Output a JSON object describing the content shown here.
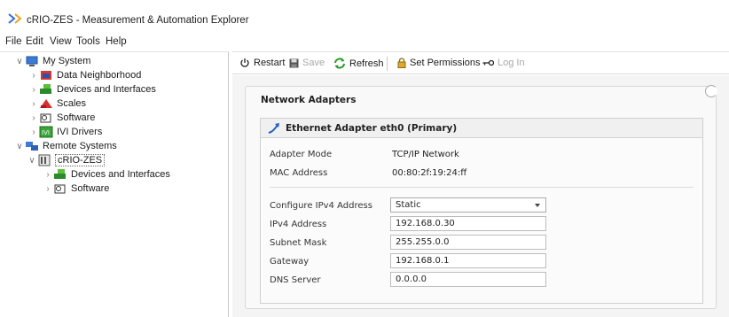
{
  "window": {
    "title": "cRIO-ZES - Measurement & Automation Explorer"
  },
  "menu": [
    "File",
    "Edit",
    "View",
    "Tools",
    "Help"
  ],
  "tree": {
    "my_system": "My System",
    "data_neighborhood": "Data Neighborhood",
    "devices_interfaces": "Devices and Interfaces",
    "scales": "Scales",
    "software": "Software",
    "ivi_drivers": "IVI Drivers",
    "remote_systems": "Remote Systems",
    "crio": "cRIO-ZES",
    "crio_devices": "Devices and Interfaces",
    "crio_software": "Software"
  },
  "toolbar": {
    "restart": "Restart",
    "save": "Save",
    "refresh": "Refresh",
    "set_permissions": "Set Permissions",
    "log_in": "Log In"
  },
  "panel": {
    "title": "Network Adapters",
    "adapter_title": "Ethernet Adapter eth0 (Primary)",
    "adapter_mode_label": "Adapter Mode",
    "adapter_mode_value": "TCP/IP Network",
    "mac_label": "MAC Address",
    "mac_value": "00:80:2f:19:24:ff",
    "config_label": "Configure IPv4 Address",
    "config_value": "Static",
    "ipv4_label": "IPv4 Address",
    "ipv4_value": "192.168.0.30",
    "subnet_label": "Subnet Mask",
    "subnet_value": "255.255.0.0",
    "gateway_label": "Gateway",
    "gateway_value": "192.168.0.1",
    "dns_label": "DNS Server",
    "dns_value": "0.0.0.0"
  },
  "colors": {
    "accent_blue": "#1f5fbf",
    "refresh_green": "#2e9b2e",
    "selection_border": "#666666"
  }
}
